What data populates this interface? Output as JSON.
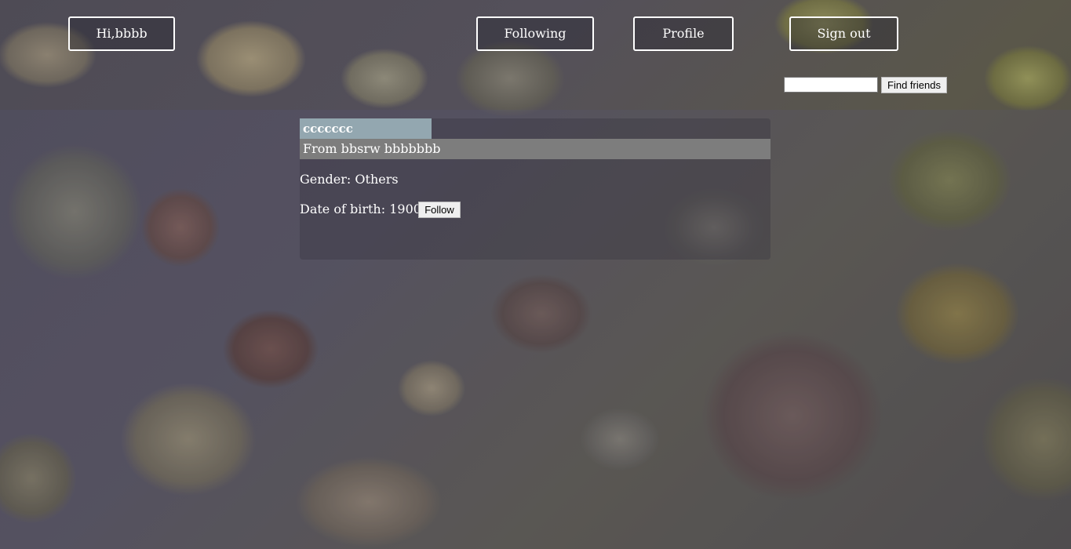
{
  "nav": {
    "greeting": "Hi,bbbb",
    "following": "Following",
    "profile": "Profile",
    "sign_out": "Sign out"
  },
  "search": {
    "value": "",
    "button_label": "Find friends"
  },
  "profile_card": {
    "username": "ccccccc",
    "from_line": "From bbsrw bbbbbbb",
    "gender_line": "Gender: Others",
    "dob_line": "Date of birth: 1900/1/1",
    "follow_label": "Follow"
  }
}
